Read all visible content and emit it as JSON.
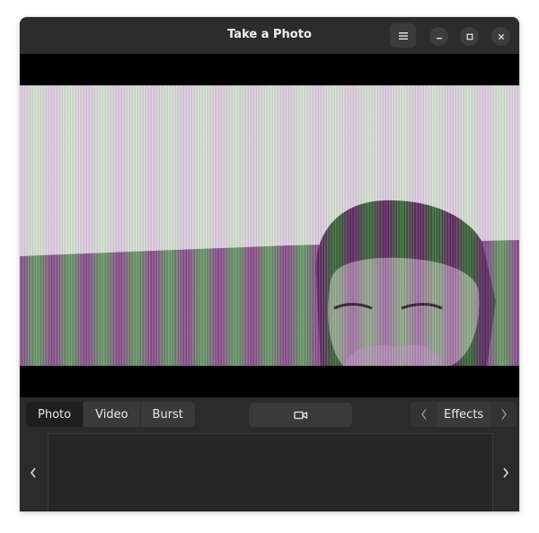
{
  "window": {
    "title": "Take a Photo"
  },
  "header": {
    "menu_icon": "hamburger-menu-icon",
    "controls": [
      "minimize-icon",
      "maximize-icon",
      "close-icon"
    ]
  },
  "modes": {
    "items": [
      {
        "label": "Photo",
        "active": true
      },
      {
        "label": "Video",
        "active": false
      },
      {
        "label": "Burst",
        "active": false
      }
    ]
  },
  "shutter": {
    "icon": "video-camera-icon"
  },
  "effects": {
    "label": "Effects",
    "prev_icon": "chevron-left-icon",
    "next_icon": "chevron-right-icon"
  },
  "strip": {
    "prev_icon": "chevron-left-icon",
    "next_icon": "chevron-right-icon"
  },
  "colors": {
    "window_bg": "#2b2b2b",
    "active_mode": "#1f1f1f",
    "button_bg": "#3a3a3a",
    "text": "#e8e8e8"
  }
}
